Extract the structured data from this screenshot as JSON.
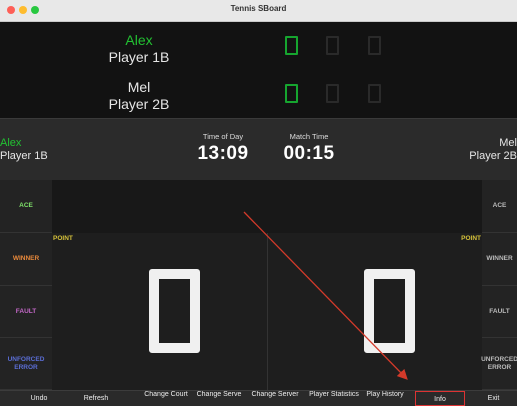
{
  "window": {
    "title": "Tennis SBoard"
  },
  "colors": {
    "name_green": "#22c232",
    "ace": "#7fe26a",
    "winner": "#e8893b",
    "fault": "#c468c8",
    "unforced": "#5b6ed6",
    "point": "#d6c23a",
    "annotation": "#d33a2a"
  },
  "players": {
    "p1": {
      "first": "Alex",
      "label": "Player 1B",
      "sets": [
        "0",
        "0",
        "0"
      ]
    },
    "p2": {
      "first": "Mel",
      "label": "Player 2B",
      "sets": [
        "0",
        "0",
        "0"
      ]
    }
  },
  "info_bar": {
    "left_first": "Alex",
    "left_label": "Player 1B",
    "right_first": "Mel",
    "right_label": "Player 2B",
    "time_of_day_label": "Time of Day",
    "time_of_day": "13:09",
    "match_time_label": "Match Time",
    "match_time": "00:15"
  },
  "side_buttons": {
    "left": [
      "ACE",
      "WINNER",
      "FAULT",
      "UNFORCED ERROR"
    ],
    "right": [
      "ACE",
      "WINNER",
      "FAULT",
      "UNFORCED ERROR"
    ]
  },
  "court": {
    "point_label": "POINT",
    "p1_points": "0",
    "p2_points": "0"
  },
  "bottom_buttons": [
    {
      "label": "Undo"
    },
    {
      "label": "Refresh"
    },
    {
      "label": "Change Court"
    },
    {
      "label": "Change Serve"
    },
    {
      "label": "Change Server"
    },
    {
      "label": "Player Statistics"
    },
    {
      "label": "Play History"
    },
    {
      "label": "Info",
      "highlighted": true
    },
    {
      "label": "Exit"
    }
  ]
}
